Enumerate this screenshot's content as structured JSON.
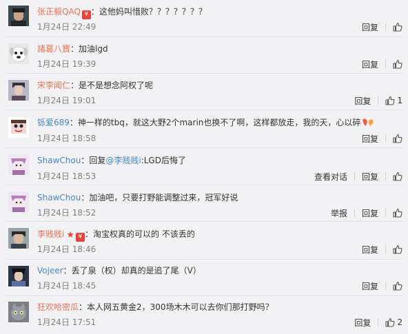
{
  "comments": [
    {
      "user": "张正毅QAQ",
      "badge": "vip",
      "text": "这他妈叫惜败？？？？？？？",
      "time": "1月24日 22:49",
      "actions": [
        "回复"
      ],
      "likes": ""
    },
    {
      "user": "諸葛八寳",
      "badge": "",
      "text": "加油lgd",
      "time": "1月24日 19:39",
      "actions": [
        "回复"
      ],
      "likes": ""
    },
    {
      "user": "宋李闻仁",
      "badge": "",
      "text": "是不是想念阿权了呢",
      "time": "1月24日 19:01",
      "actions": [
        "回复"
      ],
      "likes": "1"
    },
    {
      "user": "铄爱689",
      "badge": "",
      "text": "神一样的tbq，就这大野2个marin也换不了啊，这样都放走，我的天，心以碎",
      "time": "1月24日 18:58",
      "actions": [
        "回复"
      ],
      "likes": ""
    },
    {
      "user": "ShawChou",
      "badge": "",
      "text_prefix": "回复",
      "mention": "@李贱贱i",
      "text": ":LGD后悔了",
      "time": "1月24日 18:53",
      "actions": [
        "查看对话",
        "回复"
      ],
      "likes": ""
    },
    {
      "user": "ShawChou",
      "badge": "",
      "text": "加油吧，只要打野能调整过来，冠军好说",
      "time": "1月24日 18:52",
      "actions": [
        "举报",
        "回复"
      ],
      "likes": ""
    },
    {
      "user": "李贱贱i",
      "badge": "star-vip",
      "text": "淘宝权真的可以的 不该丢的",
      "time": "1月24日 18:46",
      "actions": [
        "回复"
      ],
      "likes": ""
    },
    {
      "user": "Vojeer",
      "badge": "",
      "text": "丢了泉（权）却真的是追了尾（V）",
      "time": "1月24日 18:45",
      "actions": [
        "回复"
      ],
      "likes": ""
    },
    {
      "user": "狂欢哈密瓜",
      "badge": "",
      "text": "本人网五黄金2，300场木木可以去你们那打野吗？",
      "time": "1月24日 17:51",
      "actions": [
        "回复"
      ],
      "likes": "2"
    }
  ],
  "badges": {
    "vip_glyph": "¥",
    "star_glyph": "★"
  },
  "colors": {
    "username": "#eb7350",
    "link": "#4a86c5",
    "time": "#808080",
    "background": "#f2f2f5"
  }
}
